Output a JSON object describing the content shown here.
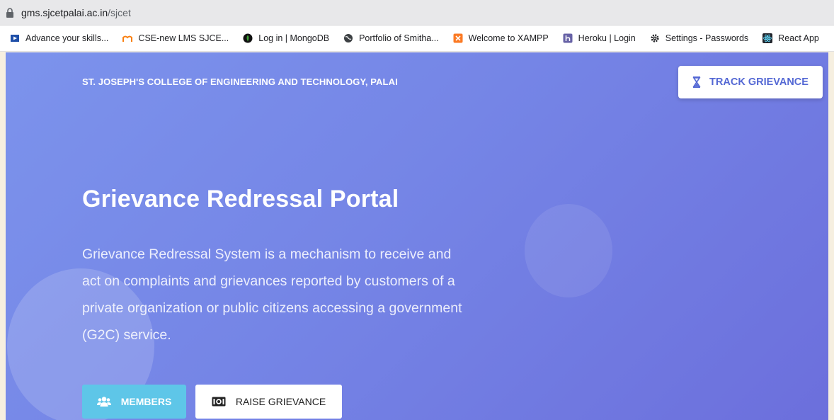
{
  "address_bar": {
    "host": "gms.sjcetpalai.ac.in",
    "path": "/sjcet"
  },
  "bookmarks": [
    {
      "label": "Advance your skills...",
      "icon": "video-icon"
    },
    {
      "label": "CSE-new  LMS SJCE...",
      "icon": "moodle-icon"
    },
    {
      "label": "Log in | MongoDB",
      "icon": "mongodb-icon"
    },
    {
      "label": "Portfolio of Smitha...",
      "icon": "globe-icon"
    },
    {
      "label": "Welcome to XAMPP",
      "icon": "xampp-icon"
    },
    {
      "label": "Heroku | Login",
      "icon": "heroku-icon"
    },
    {
      "label": "Settings - Passwords",
      "icon": "gear-icon"
    },
    {
      "label": "React App",
      "icon": "react-icon"
    }
  ],
  "header": {
    "college_name": "ST. JOSEPH'S COLLEGE OF ENGINEERING AND TECHNOLOGY, PALAI",
    "track_button": "TRACK GRIEVANCE"
  },
  "hero": {
    "title": "Grievance Redressal Portal",
    "description": "Grievance Redressal System is a mechanism to receive and act on complaints and grievances reported by customers of a private organization or public citizens accessing a government (G2C) service.",
    "members_button": "MEMBERS",
    "raise_button": "RAISE GRIEVANCE"
  },
  "colors": {
    "accent": "#5468d4",
    "members_button": "#5ec6e8",
    "hero_gradient_start": "#7c93ec",
    "hero_gradient_end": "#6c6fdc"
  }
}
